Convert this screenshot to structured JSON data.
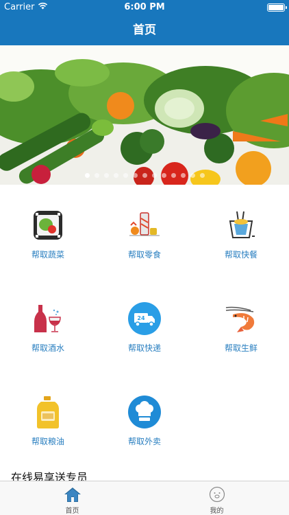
{
  "status_bar": {
    "carrier": "Carrier",
    "time": "6:00 PM"
  },
  "nav": {
    "title": "首页"
  },
  "banner": {
    "dot_count": 13,
    "active_index": 0
  },
  "categories": [
    {
      "label": "帮取蔬菜",
      "icon": "vegetable-basket-icon"
    },
    {
      "label": "帮取零食",
      "icon": "snacks-icon"
    },
    {
      "label": "帮取快餐",
      "icon": "takeout-box-icon"
    },
    {
      "label": "帮取酒水",
      "icon": "wine-icon"
    },
    {
      "label": "帮取快递",
      "icon": "delivery-truck-icon"
    },
    {
      "label": "帮取生鲜",
      "icon": "shrimp-icon"
    },
    {
      "label": "帮取粮油",
      "icon": "oil-bottle-icon"
    },
    {
      "label": "帮取外卖",
      "icon": "chef-hat-icon"
    }
  ],
  "section": {
    "title": "在线易享送专员"
  },
  "tabs": [
    {
      "label": "首页",
      "icon": "home-icon",
      "active": true
    },
    {
      "label": "我的",
      "icon": "profile-face-icon",
      "active": false
    }
  ],
  "colors": {
    "primary": "#1877bd",
    "label": "#2a7fc0",
    "tab_active_icon": "#2d6e9f"
  }
}
